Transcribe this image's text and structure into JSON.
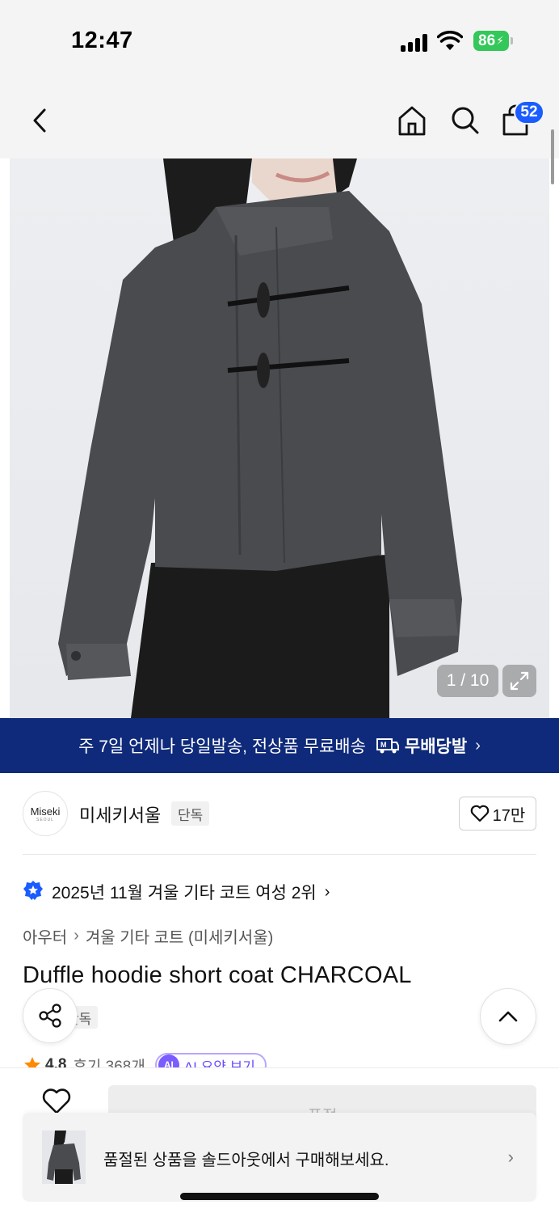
{
  "status_bar": {
    "time": "12:47",
    "battery": "86"
  },
  "nav": {
    "cart_count": "52"
  },
  "gallery": {
    "counter": "1 / 10"
  },
  "banner": {
    "text": "주 7일 언제나 당일발송, 전상품 무료배송",
    "logo_text": "무배당발",
    "logo_mark": "M"
  },
  "brand": {
    "logo_text": "Miseki",
    "logo_sub": "SEOUL",
    "name": "미세키서울",
    "tag": "단독",
    "likes": "17만"
  },
  "ranking": {
    "text": "2025년 11월 겨울 기타 코트 여성 2위"
  },
  "breadcrumb": {
    "category": "아우터",
    "subcategory": "겨울 기타 코트 (미세키서울)"
  },
  "product": {
    "title": "Duffle hoodie short coat CHARCOAL",
    "exclusive_tag": "단독",
    "rating": "4.8",
    "review_count": "후기 368개",
    "ai_badge": "AI",
    "ai_summary": "AI 요약 보기"
  },
  "bottom": {
    "soldout_button": "품절",
    "soldout_message": "품절된 상품을 솔드아웃에서 구매해보세요."
  },
  "colors": {
    "banner_bg": "#0f2a7a",
    "badge_blue": "#1a5cff",
    "ai_purple": "#7a5cff"
  }
}
